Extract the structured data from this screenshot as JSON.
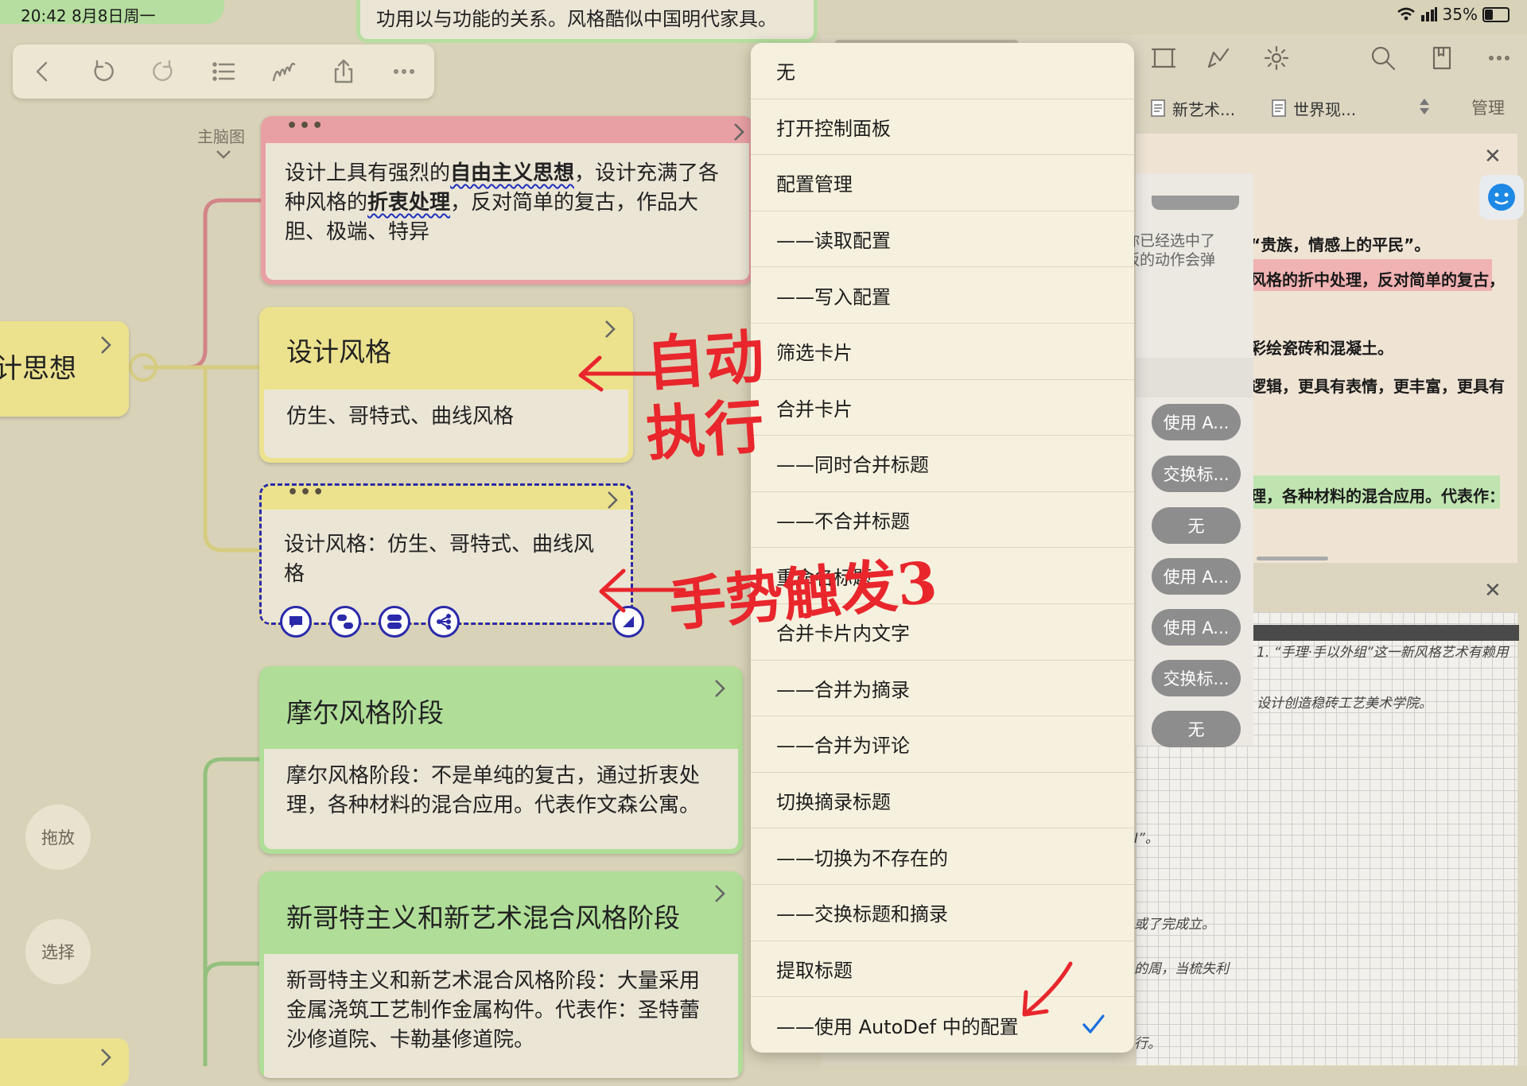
{
  "status_bar": {
    "time": "20:42  8月8日周一",
    "battery": "35%"
  },
  "toolbar": {
    "mindmap_label": "主脑图"
  },
  "top_card": {
    "text": "功用以与功能的关系。风格酷似中国明代家具。"
  },
  "root_node": {
    "label": "计思想"
  },
  "card_pink": {
    "html_parts": [
      "设计上具有强烈的",
      "自由主义思想",
      "，设计充满了各种风格的",
      "折衷处理",
      "，反对简单的复古，作品大胆、极端、特异"
    ]
  },
  "card_yellow": {
    "title": "设计风格",
    "body": "仿生、哥特式、曲线风格"
  },
  "card_dashed": {
    "body": "设计风格：仿生、哥特式、曲线风格"
  },
  "card_green1": {
    "title": "摩尔风格阶段",
    "body": "摩尔风格阶段：不是单纯的复古，通过折衷处理，各种材料的混合应用。代表作文森公寓。"
  },
  "card_green2": {
    "title": "新哥特主义和新艺术混合风格阶段",
    "body": "新哥特主义和新艺术混合风格阶段：大量采用金属浇筑工艺制作金属构件。代表作：圣特蕾沙修道院、卡勒基修道院。"
  },
  "side_buttons": {
    "drag": "拖放",
    "select": "选择"
  },
  "annotations": {
    "auto_line1": "自动",
    "auto_line2": "执行",
    "gesture": "手势触发3"
  },
  "menu": {
    "items": [
      "无",
      "打开控制面板",
      "配置管理",
      "——读取配置",
      "——写入配置",
      "筛选卡片",
      "合并卡片",
      "——同时合并标题",
      "——不合并标题",
      "重命名标题",
      "合并卡片内文字",
      "——合并为摘录",
      "——合并为评论",
      "切换摘录标题",
      "——切换为不存在的",
      "——交换标题和摘录",
      "提取标题",
      "——使用 AutoDef 中的配置"
    ],
    "checked_index": 17
  },
  "doc": {
    "manage": "管理",
    "tabs": [
      "新艺术...",
      "世界现..."
    ],
    "popup_text1": "你已经选中了",
    "popup_text2": "板的动作会弹",
    "lines": [
      "“贵族，情感上的平民”。",
      "风格的折中处理，反对简单的复古，",
      "彩绘瓷砖和混凝土。",
      "逻辑，更具有表情，更丰富，更具有",
      "理，各种材料的混合应用。代表作："
    ],
    "handwriting": [
      "1. “手理·手以外组”这一新风格艺术有赖用",
      "设计创造稳砖工艺美术学院。",
      "I”。",
      "或了完成立。",
      "的周，当梳失利",
      "行。"
    ],
    "pills": [
      "使用 A...",
      "交换标...",
      "无",
      "使用 A...",
      "使用 A...",
      "交换标...",
      "无"
    ]
  },
  "colors": {
    "pink": "#e8a0a4",
    "yellow": "#ece28e",
    "green": "#b0de98",
    "menu_bg": "#f6f1de",
    "check_blue": "#1a6fe0",
    "annotation_red": "#e8262c"
  }
}
